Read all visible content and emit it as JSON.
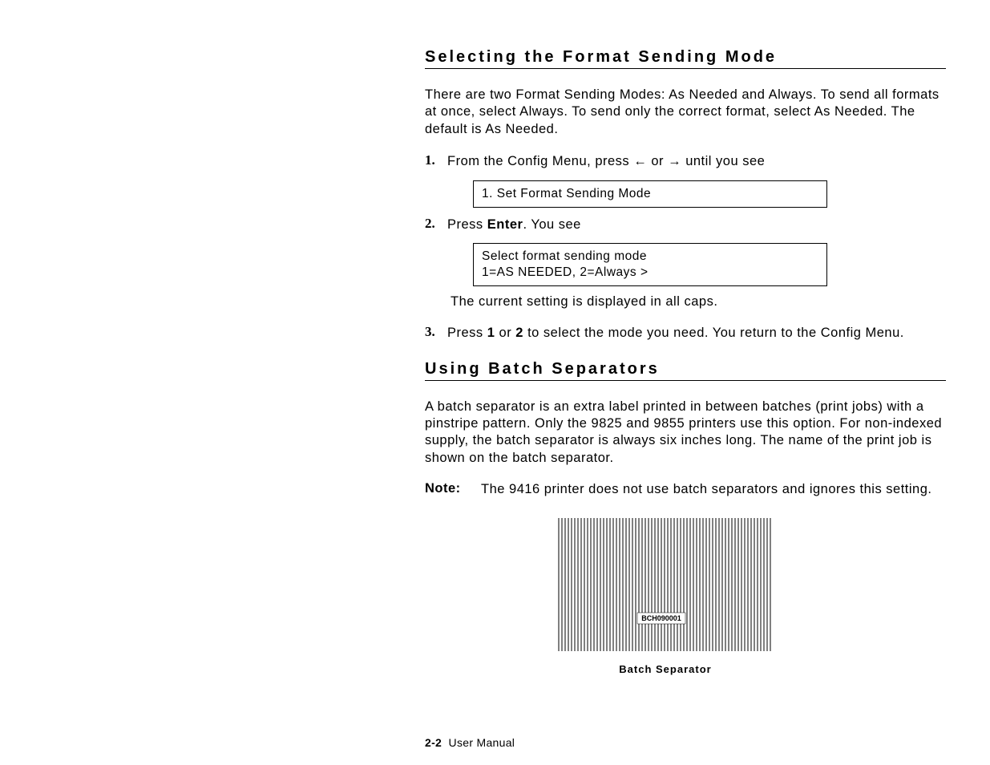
{
  "section1": {
    "heading": "Selecting the Format Sending Mode",
    "intro": "There are two Format Sending Modes: As Needed and Always. To send all formats at once, select Always. To send only the correct format, select As Needed. The default is As Needed.",
    "steps": [
      {
        "num": "1.",
        "pre": "From the Config Menu, press ",
        "mid": " or ",
        "post": " until you see",
        "box": "1. Set Format Sending Mode"
      },
      {
        "num": "2.",
        "pre": "Press ",
        "bold1": "Enter",
        "post": ". You see",
        "box_line1": "Select format sending mode",
        "box_line2": "1=AS NEEDED, 2=Always >",
        "after": "The current setting is displayed in all caps."
      },
      {
        "num": "3.",
        "pre": "Press ",
        "b1": "1",
        "mid": " or ",
        "b2": "2",
        "post": " to select the mode you need. You return to the Config Menu."
      }
    ]
  },
  "section2": {
    "heading": "Using Batch Separators",
    "intro": "A batch separator is an extra label printed in between batches (print jobs) with a pinstripe pattern. Only the 9825 and 9855 printers use this option. For non-indexed supply, the batch separator is always six inches long. The name of the print job is shown on the batch separator.",
    "note_label": "Note:",
    "note_body": "The 9416 printer does not use batch separators and ignores this setting.",
    "figure_label_text": "BCH090001",
    "caption": "Batch Separator"
  },
  "arrows": {
    "left": "←",
    "right": "→"
  },
  "footer": {
    "page": "2-2",
    "title": "User Manual"
  }
}
